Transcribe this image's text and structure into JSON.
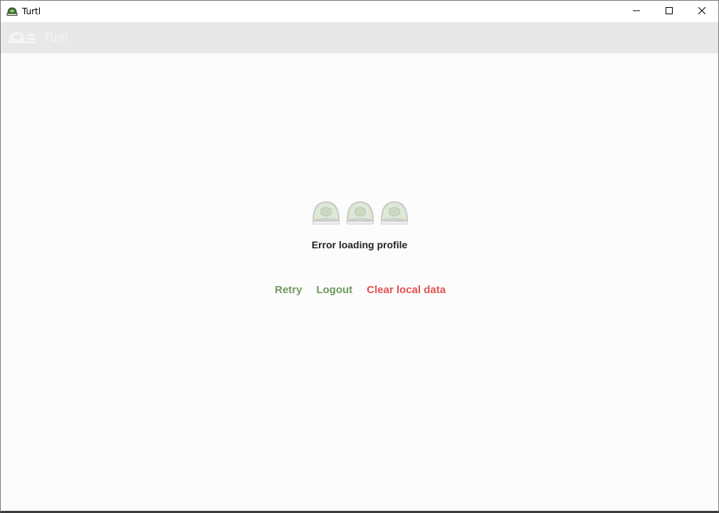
{
  "window": {
    "title": "Turtl",
    "controls": {
      "minimize_icon": "minimize-icon",
      "maximize_icon": "maximize-icon",
      "close_icon": "close-icon"
    }
  },
  "appbar": {
    "title": "Turtl",
    "menu_icon": "turtl-menu-icon"
  },
  "main": {
    "loading_icon": "turtle-shell-icon",
    "error_message": "Error loading profile",
    "actions": {
      "retry": "Retry",
      "logout": "Logout",
      "clear_local_data": "Clear local data"
    }
  },
  "colors": {
    "accent_green": "#6f9a5d",
    "danger_red": "#e35252",
    "appbar_bg": "#e8e8e8",
    "content_bg": "#fcfcfc"
  }
}
